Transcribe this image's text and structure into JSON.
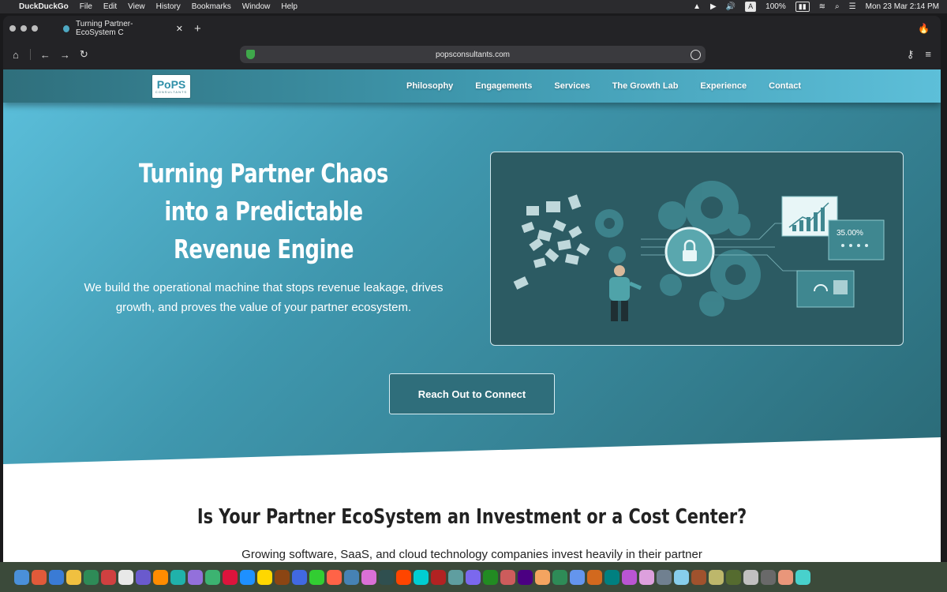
{
  "menubar": {
    "app": "DuckDuckGo",
    "items": [
      "File",
      "Edit",
      "View",
      "History",
      "Bookmarks",
      "Window",
      "Help"
    ],
    "status": {
      "keyboard": "A",
      "battery": "100%",
      "datetime": "Mon 23 Mar  2:14 PM"
    }
  },
  "browser": {
    "tab_title": "Turning Partner-EcoSystem C",
    "address": "popsconsultants.com"
  },
  "site": {
    "logo_text": "PoPS",
    "logo_sub": "CONSULTANTS",
    "nav": [
      "Philosophy",
      "Engagements",
      "Services",
      "The Growth Lab",
      "Experience",
      "Contact"
    ],
    "hero": {
      "headline": "Turning Partner Chaos into a Predictable Revenue Engine",
      "subtext": "We build the operational machine that stops revenue leakage, drives growth, and proves the value of your partner ecosystem.",
      "cta": "Reach Out to Connect",
      "illustration_stat": "35.00%"
    },
    "section": {
      "title": "Is Your Partner EcoSystem an Investment or a Cost Center?",
      "text": "Growing software, SaaS, and cloud technology companies invest heavily in their partner"
    }
  },
  "dock_colors": [
    "#4a90d9",
    "#e05a3a",
    "#3a7bd5",
    "#f0c040",
    "#2e8b57",
    "#d04040",
    "#e8e8e8",
    "#6a5acd",
    "#ff8c00",
    "#20b2aa",
    "#9370db",
    "#3cb371",
    "#dc143c",
    "#1e90ff",
    "#ffd700",
    "#8b4513",
    "#4169e1",
    "#32cd32",
    "#ff6347",
    "#4682b4",
    "#da70d6",
    "#2f4f4f",
    "#ff4500",
    "#00ced1",
    "#b22222",
    "#5f9ea0",
    "#7b68ee",
    "#228b22",
    "#cd5c5c",
    "#4b0082",
    "#f4a460",
    "#2e8b57",
    "#6495ed",
    "#d2691e",
    "#008080",
    "#ba55d3",
    "#dda0dd",
    "#708090",
    "#87ceeb",
    "#a0522d",
    "#bdb76b",
    "#556b2f",
    "#c0c0c0",
    "#696969",
    "#e9967a",
    "#48d1cc"
  ]
}
